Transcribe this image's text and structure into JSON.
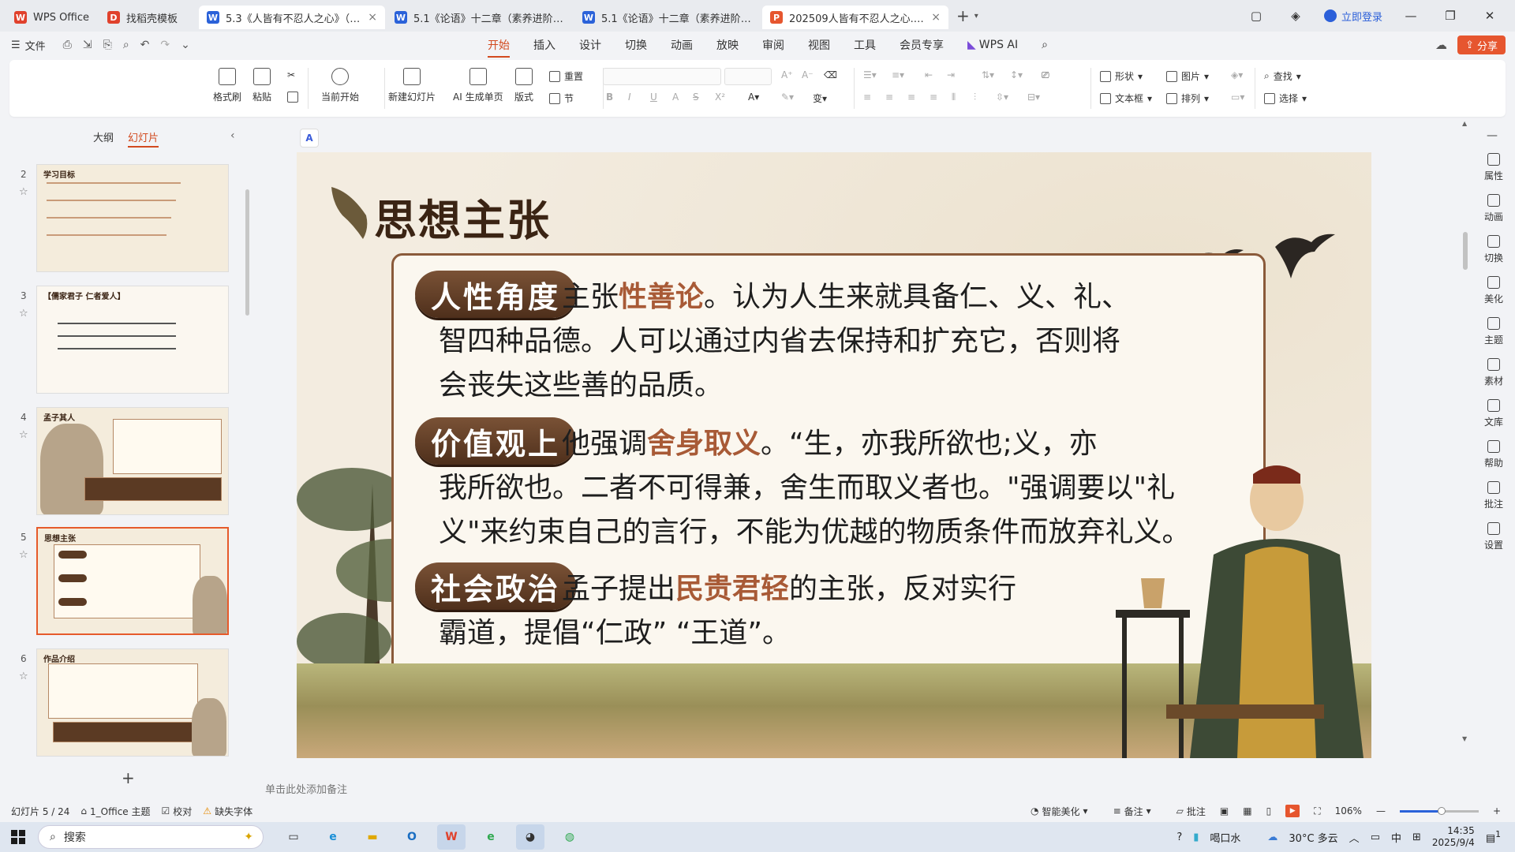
{
  "tabs": [
    {
      "label": "WPS Office",
      "icon": "wps-logo-icon",
      "color": "#e0412c",
      "glyph": "W",
      "closable": false
    },
    {
      "label": "找稻壳模板",
      "icon": "daoke-icon",
      "color": "#e0412c",
      "glyph": "D",
      "closable": false
    },
    {
      "label": "5.3《人皆有不忍人之心》（同步...",
      "icon": "word-doc-icon",
      "color": "#2b62d9",
      "glyph": "W",
      "closable": true
    },
    {
      "label": "5.1《论语》十二章（素养进阶分层",
      "icon": "word-doc-icon",
      "color": "#2b62d9",
      "glyph": "W",
      "closable": false
    },
    {
      "label": "5.1《论语》十二章（素养进阶分层",
      "icon": "word-doc-icon",
      "color": "#2b62d9",
      "glyph": "W",
      "closable": false
    },
    {
      "label": "202509人皆有不忍人之心.pp",
      "icon": "ppt-doc-icon",
      "color": "#e6562f",
      "glyph": "P",
      "closable": true
    }
  ],
  "titlebar": {
    "login": "立即登录"
  },
  "menubar": {
    "file": "文件",
    "menus": [
      "开始",
      "插入",
      "设计",
      "切换",
      "动画",
      "放映",
      "审阅",
      "视图",
      "工具",
      "会员专享"
    ],
    "wps_ai": "WPS AI",
    "share": "分享"
  },
  "ribbon": {
    "format_painter": "格式刷",
    "paste": "粘贴",
    "play_from": "当前开始",
    "new_slide": "新建幻灯片",
    "ai_single": "AI 生成单页",
    "layout": "版式",
    "reset": "重置",
    "section": "节",
    "shape": "形状",
    "picture": "图片",
    "textbox": "文本框",
    "arrange": "排列",
    "find": "查找",
    "select": "选择"
  },
  "leftpanel": {
    "tab_outline": "大纲",
    "tab_slides": "幻灯片",
    "thumbs": [
      {
        "num": "2",
        "title": "学习目标"
      },
      {
        "num": "3",
        "title": "【儒家君子 仁者爱人】"
      },
      {
        "num": "4",
        "title": "孟子其人"
      },
      {
        "num": "5",
        "title": "思想主张"
      },
      {
        "num": "6",
        "title": "作品介绍"
      }
    ]
  },
  "slide": {
    "title": "思想主张",
    "sections": [
      {
        "label": "人性角度",
        "parts": [
          "主张",
          "性善论",
          "。认为人生来就具备仁、义、礼、",
          "智四种品德。人可以通过内省去保持和扩充它，否则将",
          "会丧失这些善的品质。"
        ]
      },
      {
        "label": "价值观上",
        "parts": [
          "他强调",
          "舍身取义",
          "。“生，亦我所欲也;义，亦",
          "我所欲也。二者不可得兼，舍生而取义者也。\"强调要以\"礼",
          "义\"来约束自己的言行，不能为优越的物质条件而放弃礼义。"
        ]
      },
      {
        "label": "社会政治",
        "parts": [
          "孟子提出",
          "民贵君轻",
          "的主张，反对实行",
          "霸道，提倡“仁政” “王道”。"
        ]
      }
    ]
  },
  "rightsidebar": [
    "属性",
    "动画",
    "切换",
    "美化",
    "主题",
    "素材",
    "文库",
    "帮助",
    "批注",
    "设置"
  ],
  "notes_placeholder": "单击此处添加备注",
  "statusbar": {
    "slide_pos": "幻灯片 5 / 24",
    "theme": "1_Office 主题",
    "proof": "校对",
    "missing_font": "缺失字体",
    "beautify": "智能美化",
    "notes": "备注",
    "comments": "批注",
    "zoom": "106%"
  },
  "taskbar": {
    "search": "搜索",
    "weather": "30°C 多云",
    "tip": "喝口水",
    "ime": "中",
    "time": "14:35",
    "date": "2025/9/4",
    "notif": "1"
  },
  "colors": {
    "accent": "#d24a1f",
    "pill": "#5b3a23",
    "emphasis": "#a85a36"
  }
}
